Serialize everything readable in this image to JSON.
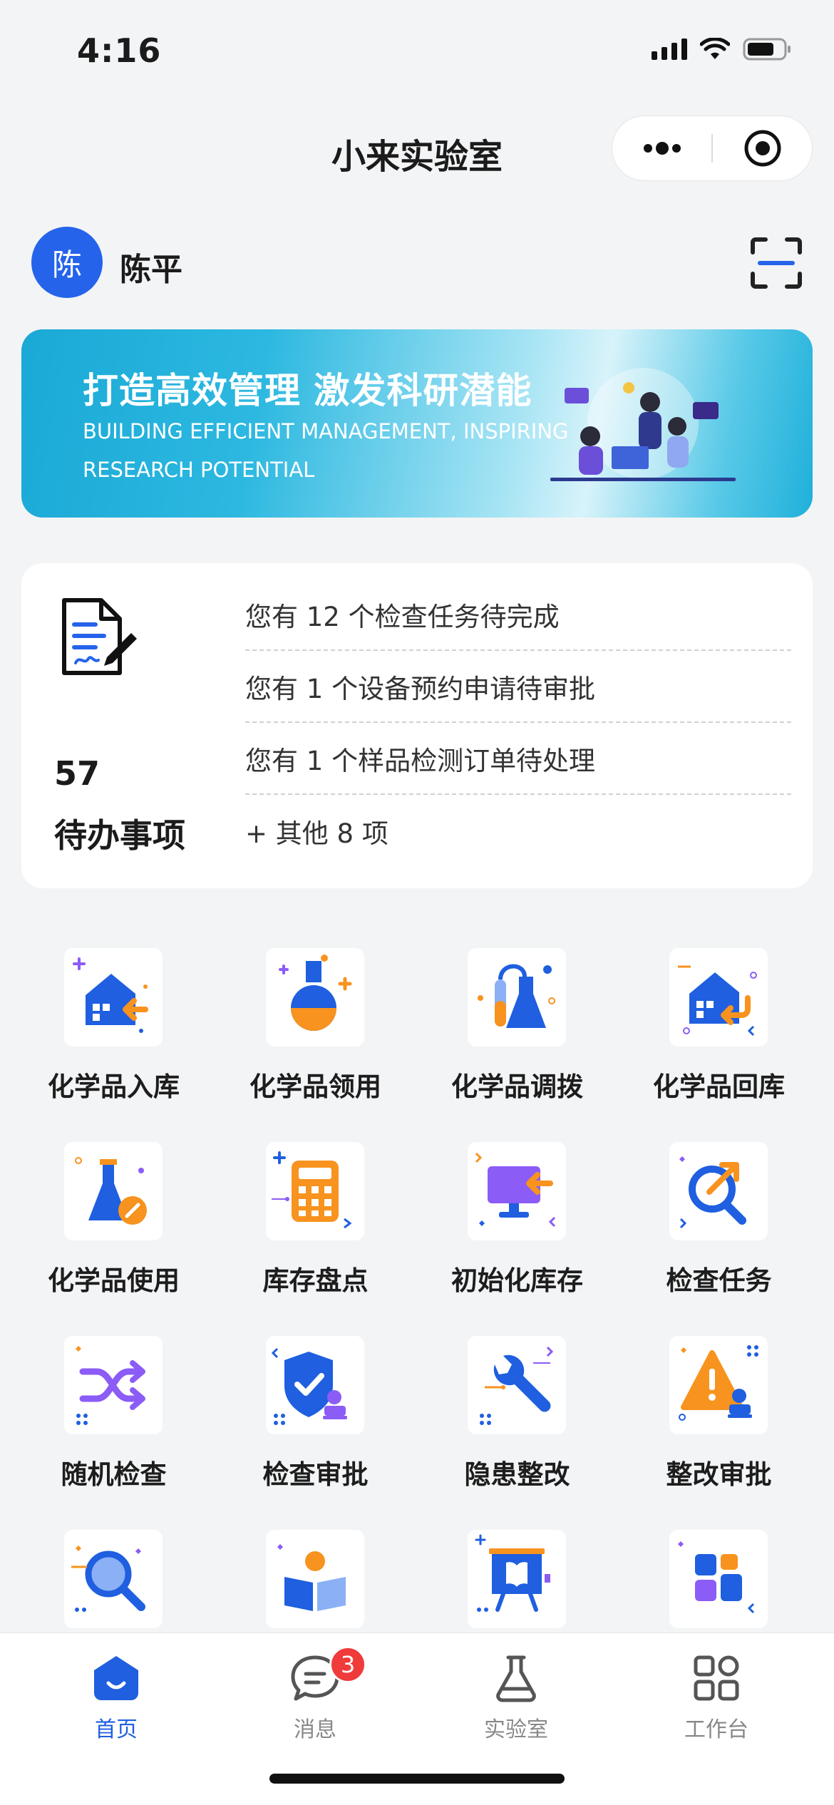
{
  "status_bar": {
    "time": "4:16"
  },
  "nav": {
    "title": "小来实验室"
  },
  "user": {
    "avatar_text": "陈",
    "name": "陈平"
  },
  "banner": {
    "title": "打造高效管理 激发科研潜能",
    "subtitle": "BUILDING EFFICIENT MANAGEMENT, INSPIRING RESEARCH POTENTIAL"
  },
  "todo": {
    "count": "57",
    "label": "待办事项",
    "items": [
      "您有 12 个检查任务待完成",
      "您有 1 个设备预约申请待审批",
      "您有 1 个样品检测订单待处理",
      "+ 其他 8 项"
    ]
  },
  "grid": {
    "items": [
      {
        "label": "化学品入库",
        "icon": "warehouse-in-icon"
      },
      {
        "label": "化学品领用",
        "icon": "flask-icon"
      },
      {
        "label": "化学品调拨",
        "icon": "test-tube-flask-icon"
      },
      {
        "label": "化学品回库",
        "icon": "warehouse-return-icon"
      },
      {
        "label": "化学品使用",
        "icon": "flask-pencil-icon"
      },
      {
        "label": "库存盘点",
        "icon": "calculator-icon"
      },
      {
        "label": "初始化库存",
        "icon": "monitor-import-icon"
      },
      {
        "label": "检查任务",
        "icon": "magnifier-arrow-icon"
      },
      {
        "label": "随机检查",
        "icon": "shuffle-icon"
      },
      {
        "label": "检查审批",
        "icon": "shield-check-icon"
      },
      {
        "label": "隐患整改",
        "icon": "wrench-icon"
      },
      {
        "label": "整改审批",
        "icon": "warning-stamp-icon"
      },
      {
        "label": "",
        "icon": "search-icon"
      },
      {
        "label": "",
        "icon": "reading-person-icon"
      },
      {
        "label": "",
        "icon": "presentation-board-icon"
      },
      {
        "label": "",
        "icon": "apps-grid-icon"
      }
    ]
  },
  "tabs": [
    {
      "label": "首页",
      "icon": "home-icon",
      "active": true
    },
    {
      "label": "消息",
      "icon": "message-icon",
      "badge": "3"
    },
    {
      "label": "实验室",
      "icon": "lab-flask-icon"
    },
    {
      "label": "工作台",
      "icon": "workbench-grid-icon"
    }
  ],
  "colors": {
    "primary": "#2563eb",
    "accent": "#f7931e",
    "purple": "#8b5cf6",
    "badge": "#f03b3b"
  }
}
